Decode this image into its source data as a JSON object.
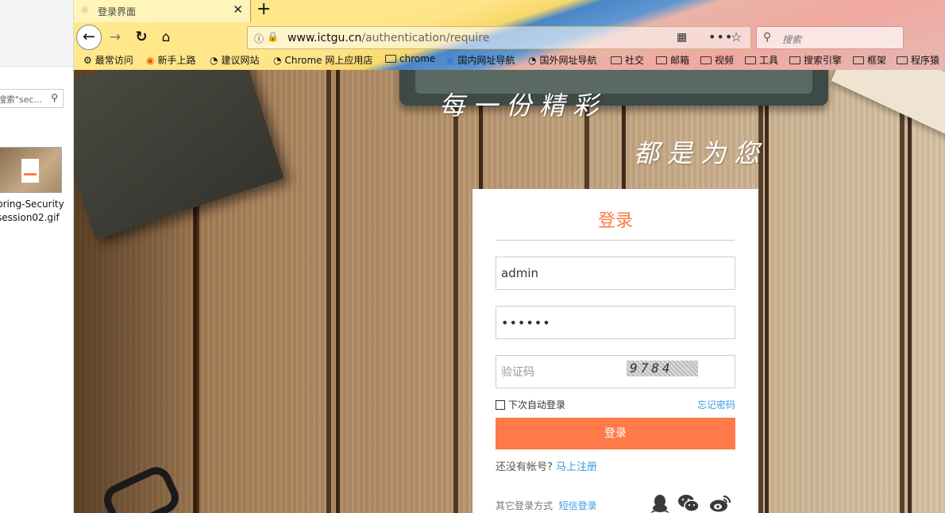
{
  "explorer": {
    "search_text": "搜索\"sec...",
    "file_name_line1": "pring-Security",
    "file_name_line2": "session02.gif"
  },
  "browser": {
    "tab_title": "登录界面",
    "url_host": "www.ictgu.cn",
    "url_path": "/authentication/require",
    "search_placeholder": "搜索",
    "bookmarks": [
      {
        "label": "最常访问",
        "icon": "gear-icon"
      },
      {
        "label": "新手上路",
        "icon": "firefox-icon"
      },
      {
        "label": "建议网站",
        "icon": "globe-icon"
      },
      {
        "label": "Chrome 网上应用店",
        "icon": "globe-icon"
      },
      {
        "label": "chrome",
        "icon": "folder-icon"
      },
      {
        "label": "国内网址导航",
        "icon": "image-icon"
      },
      {
        "label": "国外网址导航",
        "icon": "globe-icon"
      },
      {
        "label": "社交",
        "icon": "folder-icon"
      },
      {
        "label": "邮箱",
        "icon": "folder-icon"
      },
      {
        "label": "视频",
        "icon": "folder-icon"
      },
      {
        "label": "工具",
        "icon": "folder-icon"
      },
      {
        "label": "搜索引擎",
        "icon": "folder-icon"
      },
      {
        "label": "框架",
        "icon": "folder-icon"
      },
      {
        "label": "程序猿",
        "icon": "folder-icon"
      }
    ]
  },
  "page": {
    "slogan_line1": "每一份精彩",
    "slogan_line2": "都是为您",
    "login": {
      "title": "登录",
      "username_value": "admin",
      "password_value": "••••••",
      "captcha_placeholder": "验证码",
      "captcha_code": "9784",
      "remember_label": "下次自动登录",
      "forgot_label": "忘记密码",
      "submit_label": "登录",
      "no_account_label": "还没有帐号?",
      "register_label": "马上注册",
      "other_login_label": "其它登录方式",
      "sms_login_label": "短信登录"
    }
  },
  "colors": {
    "accent": "#ff7a48",
    "link": "#3a9de0"
  }
}
